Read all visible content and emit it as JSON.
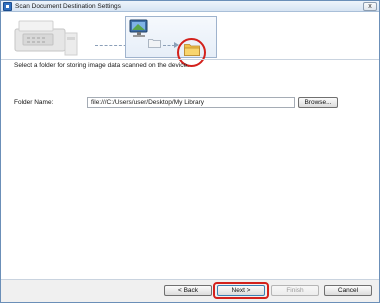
{
  "window": {
    "title": "Scan Document Destination Settings"
  },
  "titlebar": {
    "close_glyph": "x"
  },
  "banner": {
    "illustration_icons": [
      "scanner-icon",
      "computer-monitor-icon",
      "folder-icon",
      "folder-open-icon"
    ],
    "highlight_color": "#d3211c"
  },
  "instruction": "Select a folder for storing image data scanned on the device.",
  "folder": {
    "label": "Folder Name:",
    "value": "file:///C:/Users/user/Desktop/My Library",
    "browse_label": "Browse..."
  },
  "footer": {
    "back_label": "< Back",
    "next_label": "Next >",
    "finish_label": "Finish",
    "cancel_label": "Cancel"
  }
}
